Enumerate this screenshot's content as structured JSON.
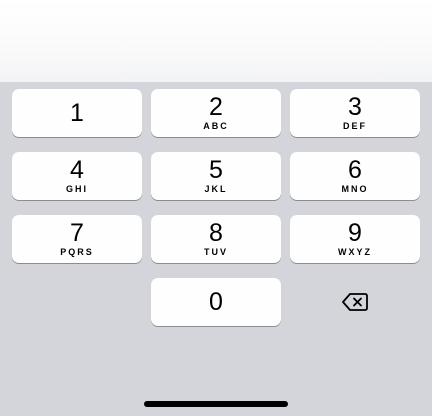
{
  "keypad": {
    "keys": [
      {
        "digit": "1",
        "letters": ""
      },
      {
        "digit": "2",
        "letters": "ABC"
      },
      {
        "digit": "3",
        "letters": "DEF"
      },
      {
        "digit": "4",
        "letters": "GHI"
      },
      {
        "digit": "5",
        "letters": "JKL"
      },
      {
        "digit": "6",
        "letters": "MNO"
      },
      {
        "digit": "7",
        "letters": "PQRS"
      },
      {
        "digit": "8",
        "letters": "TUV"
      },
      {
        "digit": "9",
        "letters": "WXYZ"
      },
      {
        "digit": "0",
        "letters": ""
      }
    ],
    "delete_icon": "delete-backspace-icon",
    "colors": {
      "keypad_background": "#d3d5db",
      "key_background": "#fefefe",
      "text": "#000000"
    }
  }
}
